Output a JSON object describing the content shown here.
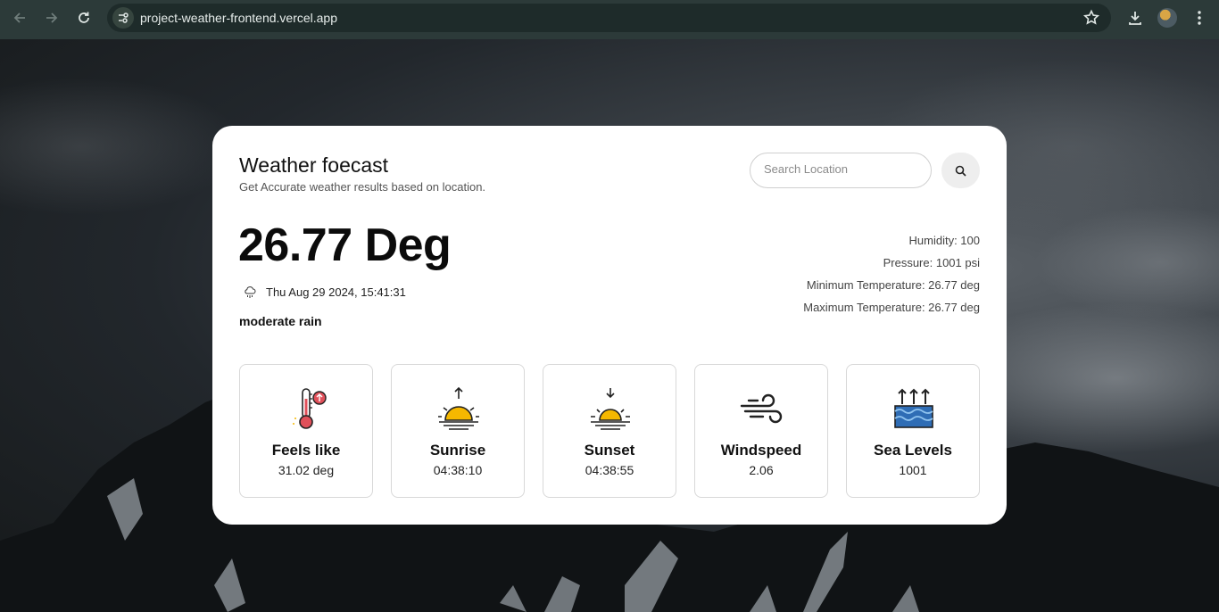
{
  "browser": {
    "url": "project-weather-frontend.vercel.app"
  },
  "header": {
    "title": "Weather foecast",
    "subtitle": "Get Accurate weather results based on location."
  },
  "search": {
    "placeholder": "Search Location",
    "value": ""
  },
  "current": {
    "temperature": "26.77 Deg",
    "datetime": "Thu Aug 29 2024, 15:41:31",
    "description": "moderate rain",
    "weather_icon": "rain-cloud-icon"
  },
  "stats": [
    {
      "label": "Humidity: 100"
    },
    {
      "label": "Pressure: 1001 psi"
    },
    {
      "label": "Minimum Temperature: 26.77 deg"
    },
    {
      "label": "Maximum Temperature: 26.77 deg"
    }
  ],
  "tiles": [
    {
      "label": "Feels like",
      "value": "31.02 deg",
      "icon": "thermometer-icon"
    },
    {
      "label": "Sunrise",
      "value": "04:38:10",
      "icon": "sunrise-icon"
    },
    {
      "label": "Sunset",
      "value": "04:38:55",
      "icon": "sunset-icon"
    },
    {
      "label": "Windspeed",
      "value": "2.06",
      "icon": "wind-icon"
    },
    {
      "label": "Sea Levels",
      "value": "1001",
      "icon": "sea-level-icon"
    }
  ],
  "colors": {
    "accent_sun": "#f5b800",
    "thermometer_red": "#e0505a",
    "water_blue": "#2f6db5"
  }
}
